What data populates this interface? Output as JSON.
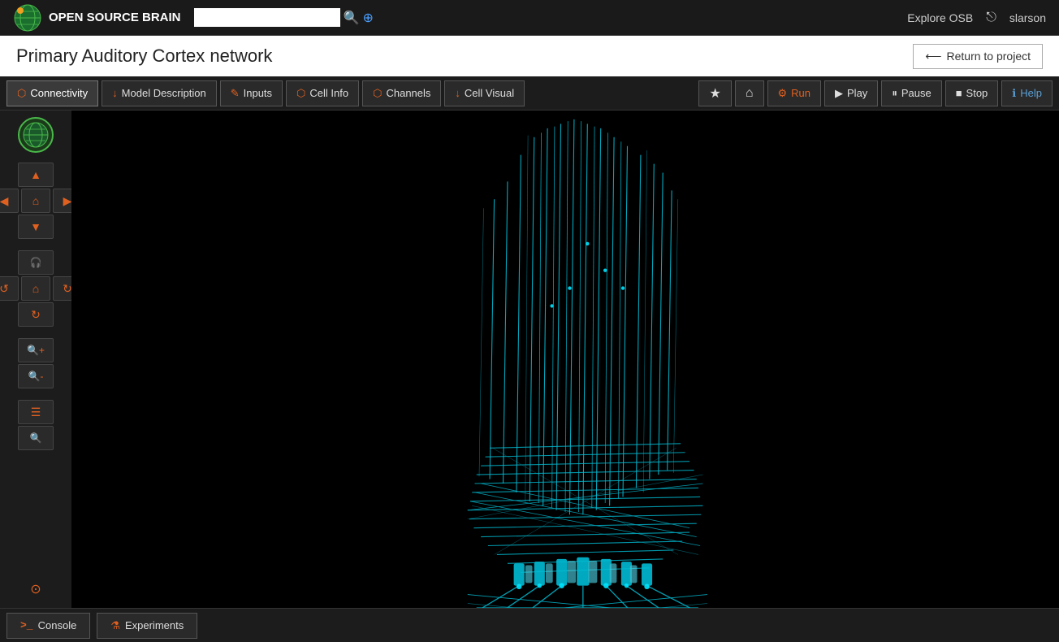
{
  "app": {
    "logo_text": "OPEN SOURCE BRAIN",
    "username": "slarson",
    "explore_link": "Explore OSB"
  },
  "search": {
    "placeholder": "",
    "value": ""
  },
  "project": {
    "title": "Primary Auditory Cortex network",
    "return_label": "Return to project"
  },
  "tabs": [
    {
      "id": "connectivity",
      "icon": "⬡",
      "label": "Connectivity",
      "active": true
    },
    {
      "id": "model-description",
      "icon": "↓",
      "label": "Model Description",
      "active": false
    },
    {
      "id": "inputs",
      "icon": "✎",
      "label": "Inputs",
      "active": false
    },
    {
      "id": "cell-info",
      "icon": "⬡",
      "label": "Cell Info",
      "active": false
    },
    {
      "id": "channels",
      "icon": "⬡",
      "label": "Channels",
      "active": false
    },
    {
      "id": "cell-visual",
      "icon": "↓",
      "label": "Cell Visual",
      "active": false
    }
  ],
  "right_toolbar": [
    {
      "id": "star",
      "icon": "★",
      "label": ""
    },
    {
      "id": "home",
      "icon": "⌂",
      "label": ""
    },
    {
      "id": "run",
      "icon": "⚙",
      "label": "Run"
    },
    {
      "id": "play",
      "icon": "▶",
      "label": "Play"
    },
    {
      "id": "pause",
      "icon": "⏸",
      "label": "Pause"
    },
    {
      "id": "stop",
      "icon": "■",
      "label": "Stop"
    },
    {
      "id": "help",
      "icon": "ℹ",
      "label": "Help"
    }
  ],
  "sidebar_buttons": [
    {
      "id": "up",
      "icon": "▲"
    },
    {
      "id": "left",
      "icon": "◀"
    },
    {
      "id": "center-home",
      "icon": "⌂"
    },
    {
      "id": "right",
      "icon": "▶"
    },
    {
      "id": "down",
      "icon": "▼"
    },
    {
      "id": "headphone",
      "icon": "🎧"
    },
    {
      "id": "undo",
      "icon": "↺"
    },
    {
      "id": "home2",
      "icon": "⌂"
    },
    {
      "id": "redo",
      "icon": "↻"
    },
    {
      "id": "refresh",
      "icon": "↻"
    },
    {
      "id": "zoom-in",
      "icon": "🔍"
    },
    {
      "id": "zoom-out",
      "icon": "🔍"
    },
    {
      "id": "list",
      "icon": "☰"
    },
    {
      "id": "search2",
      "icon": "🔍"
    },
    {
      "id": "github",
      "icon": "⊙"
    }
  ],
  "bottom_tabs": [
    {
      "id": "console",
      "icon": ">_",
      "label": "Console"
    },
    {
      "id": "experiments",
      "icon": "⚗",
      "label": "Experiments"
    }
  ]
}
